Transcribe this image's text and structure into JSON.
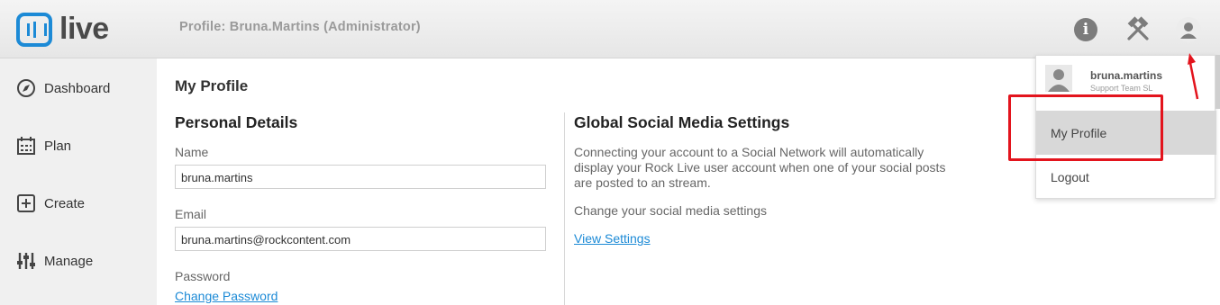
{
  "header": {
    "logo_text": "live",
    "profile_title": "Profile: Bruna.Martins (Administrator)",
    "icons": [
      "info-icon",
      "tools-icon",
      "user-icon"
    ]
  },
  "sidebar": {
    "items": [
      {
        "label": "Dashboard",
        "icon": "compass-icon"
      },
      {
        "label": "Plan",
        "icon": "calendar-icon"
      },
      {
        "label": "Create",
        "icon": "plus-square-icon"
      },
      {
        "label": "Manage",
        "icon": "sliders-icon"
      }
    ]
  },
  "main": {
    "title": "My Profile",
    "personal": {
      "title": "Personal Details",
      "name_label": "Name",
      "name_value": "bruna.martins",
      "email_label": "Email",
      "email_value": "bruna.martins@rockcontent.com",
      "password_label": "Password",
      "change_password": "Change Password"
    },
    "social": {
      "title": "Global Social Media Settings",
      "description_lines": [
        "Connecting your account to a Social Network will automatically",
        "display your Rock Live user account when one of your social posts",
        "are posted to an stream."
      ],
      "change_text": "Change your social media settings",
      "view_settings": "View Settings"
    }
  },
  "dropdown": {
    "username": "bruna.martins",
    "team": "Support Team SL",
    "items": [
      "My Profile",
      "Logout"
    ]
  },
  "colors": {
    "accent": "#1c8ad6",
    "annotation": "#e3141d"
  }
}
